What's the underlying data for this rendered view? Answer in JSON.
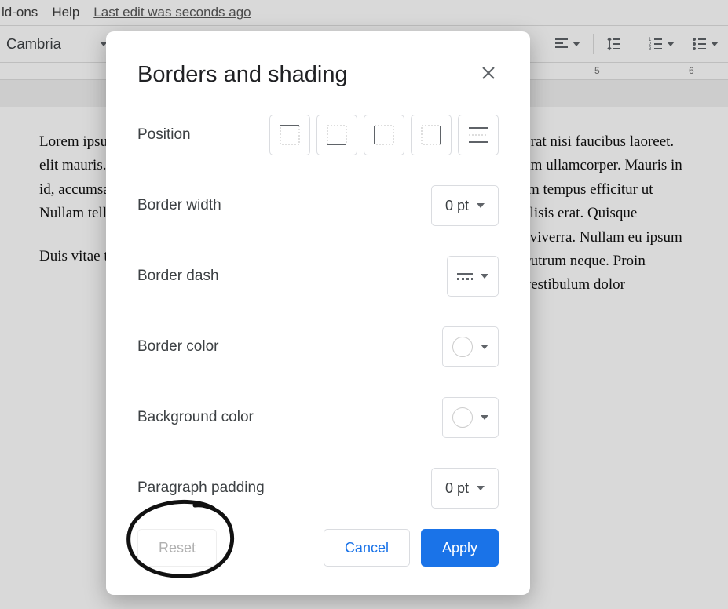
{
  "menubar": {
    "addons": "ld-ons",
    "help": "Help",
    "last_edit": "Last edit was seconds ago"
  },
  "toolbar": {
    "font_name": "Cambria"
  },
  "ruler": {
    "marks": [
      "5",
      "6"
    ]
  },
  "document": {
    "col1_p1": "Lorem ipsum dolor sit amet, consectetur adipiscing elit mauris. Suspendisse turpis sapien, malesuada id, accumsan nec, mollis urna. Maecenas id tellus. Nullam tellus. Donec est. Sed id",
    "col1_p2": "Duis vitae tempor condimentum id dui.",
    "col2_p1": "Praesent malesuada placerat nisi faucibus laoreet. Nulla imperdiet vestibulum ullamcorper. Mauris in nisi tempor sed elementum tempus efficitur ut tellus. Nunc pulvinar facilisis erat. Quisque volutpat sagittis arcu sed viverra. Nullam eu ipsum iaculis, auctor urna non, rutrum neque. Proin laoreet tortor risus, quis vestibulum dolor"
  },
  "dialog": {
    "title": "Borders and shading",
    "position_label": "Position",
    "border_width_label": "Border width",
    "border_width_value": "0 pt",
    "border_dash_label": "Border dash",
    "border_color_label": "Border color",
    "background_color_label": "Background color",
    "paragraph_padding_label": "Paragraph padding",
    "paragraph_padding_value": "0 pt",
    "reset": "Reset",
    "cancel": "Cancel",
    "apply": "Apply"
  }
}
